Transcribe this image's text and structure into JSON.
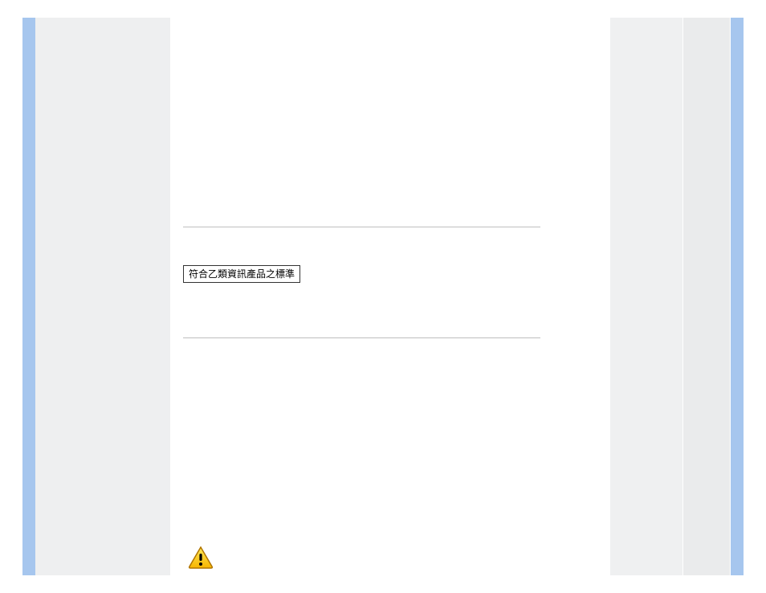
{
  "content": {
    "boxed_label": "符合乙類資訊產品之標準"
  },
  "icons": {
    "warning": "warning-icon"
  }
}
